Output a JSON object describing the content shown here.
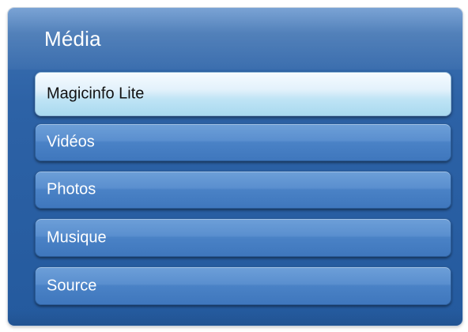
{
  "panel": {
    "title": "Média"
  },
  "menu": {
    "items": [
      {
        "label": "Magicinfo Lite",
        "selected": true
      },
      {
        "label": "Vidéos",
        "selected": false
      },
      {
        "label": "Photos",
        "selected": false
      },
      {
        "label": "Musique",
        "selected": false
      },
      {
        "label": "Source",
        "selected": false
      }
    ]
  },
  "colors": {
    "panel_background": "#2d62a6",
    "item_background": "#5a8fcf",
    "selected_background": "#d9eef9",
    "text_light": "#ffffff",
    "text_dark": "#111111"
  }
}
